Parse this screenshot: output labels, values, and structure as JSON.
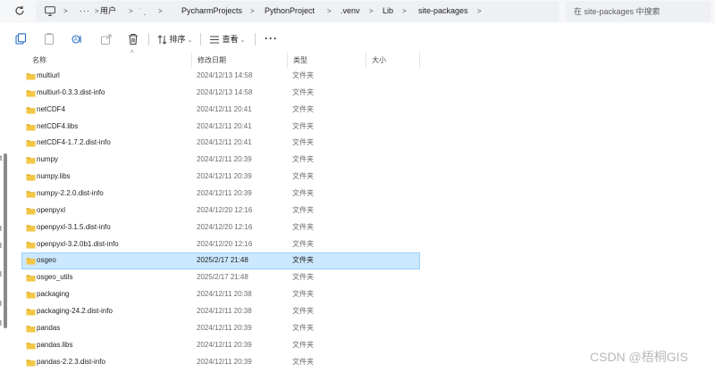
{
  "address_bar": {
    "segments": [
      "用户",
      "PycharmProjects",
      "PythonProject",
      ".venv",
      "Lib",
      "site-packages"
    ],
    "obscured_segment": "˙ ˛",
    "ellipsis": "···",
    "separator": ">"
  },
  "search": {
    "placeholder": "在 site-packages 中搜索"
  },
  "toolbar": {
    "sort_label": "排序",
    "view_label": "查看",
    "more": "···",
    "caret": "⌄"
  },
  "columns": {
    "name": "名称",
    "date": "修改日期",
    "type": "类型",
    "size": "大小"
  },
  "files": [
    {
      "name": "multiurl",
      "date": "2024/12/13 14:58",
      "type": "文件夹",
      "selected": false
    },
    {
      "name": "multiurl-0.3.3.dist-info",
      "date": "2024/12/13 14:58",
      "type": "文件夹",
      "selected": false
    },
    {
      "name": "netCDF4",
      "date": "2024/12/11 20:41",
      "type": "文件夹",
      "selected": false
    },
    {
      "name": "netCDF4.libs",
      "date": "2024/12/11 20:41",
      "type": "文件夹",
      "selected": false
    },
    {
      "name": "netCDF4-1.7.2.dist-info",
      "date": "2024/12/11 20:41",
      "type": "文件夹",
      "selected": false
    },
    {
      "name": "numpy",
      "date": "2024/12/11 20:39",
      "type": "文件夹",
      "selected": false
    },
    {
      "name": "numpy.libs",
      "date": "2024/12/11 20:39",
      "type": "文件夹",
      "selected": false
    },
    {
      "name": "numpy-2.2.0.dist-info",
      "date": "2024/12/11 20:39",
      "type": "文件夹",
      "selected": false
    },
    {
      "name": "openpyxl",
      "date": "2024/12/20 12:16",
      "type": "文件夹",
      "selected": false
    },
    {
      "name": "openpyxl-3.1.5.dist-info",
      "date": "2024/12/20 12:16",
      "type": "文件夹",
      "selected": false
    },
    {
      "name": "openpyxl-3.2.0b1.dist-info",
      "date": "2024/12/20 12:16",
      "type": "文件夹",
      "selected": false
    },
    {
      "name": "osgeo",
      "date": "2025/2/17 21:48",
      "type": "文件夹",
      "selected": true
    },
    {
      "name": "osgeo_utils",
      "date": "2025/2/17 21:48",
      "type": "文件夹",
      "selected": false
    },
    {
      "name": "packaging",
      "date": "2024/12/11 20:38",
      "type": "文件夹",
      "selected": false
    },
    {
      "name": "packaging-24.2.dist-info",
      "date": "2024/12/11 20:38",
      "type": "文件夹",
      "selected": false
    },
    {
      "name": "pandas",
      "date": "2024/12/11 20:39",
      "type": "文件夹",
      "selected": false
    },
    {
      "name": "pandas.libs",
      "date": "2024/12/11 20:39",
      "type": "文件夹",
      "selected": false
    },
    {
      "name": "pandas-2.2.3.dist-info",
      "date": "2024/12/11 20:39",
      "type": "文件夹",
      "selected": false
    }
  ],
  "left_nav_glyphs": [
    "t",
    "l",
    "l",
    "l",
    "l",
    "l"
  ],
  "watermark": "CSDN @梧桐GIS",
  "colors": {
    "folder": "#f3c745",
    "folder_dark": "#e0ac24",
    "selection_bg": "#cce8ff",
    "selection_border": "#99d1ff"
  }
}
